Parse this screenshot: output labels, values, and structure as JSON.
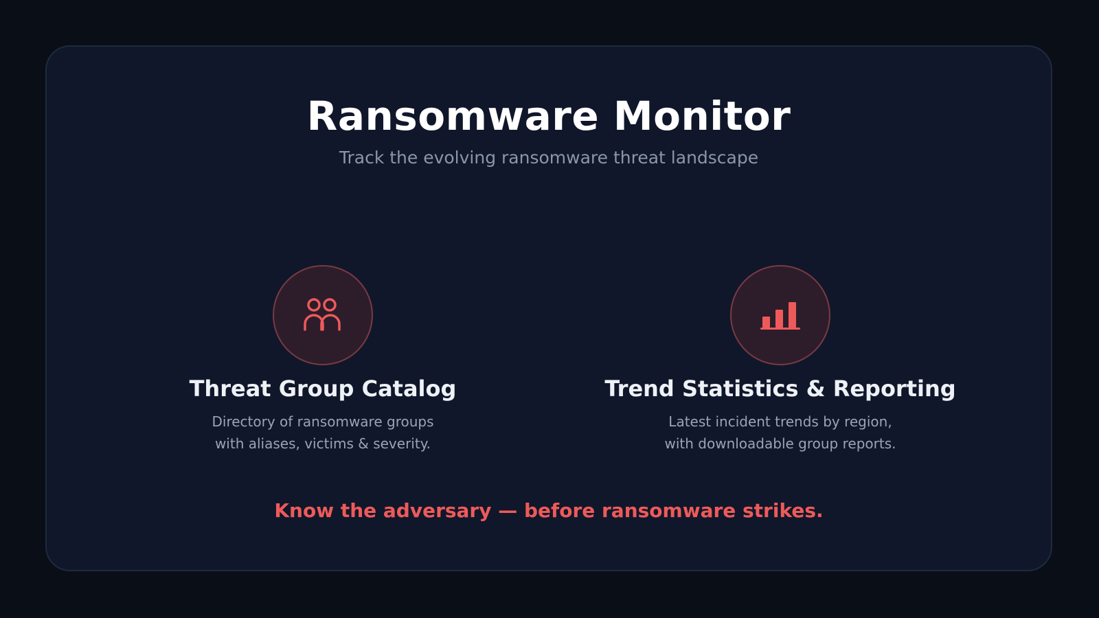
{
  "header": {
    "title": "Ransomware Monitor",
    "subtitle": "Track the evolving ransomware threat landscape"
  },
  "features": [
    {
      "icon": "users-icon",
      "title": "Threat Group Catalog",
      "description_lines": [
        "Directory of ransomware groups",
        "with aliases, victims & severity."
      ]
    },
    {
      "icon": "bar-chart-icon",
      "title": "Trend Statistics & Reporting",
      "description_lines": [
        "Latest incident trends by region,",
        "with downloadable group reports."
      ]
    }
  ],
  "tagline": "Know the adversary — before ransomware strikes.",
  "colors": {
    "background": "#0a0e17",
    "card": "#10172a",
    "accent": "#ee5a5a",
    "icon_circle_fill": "#2d1d2b",
    "icon_circle_border": "#7a3a42"
  }
}
